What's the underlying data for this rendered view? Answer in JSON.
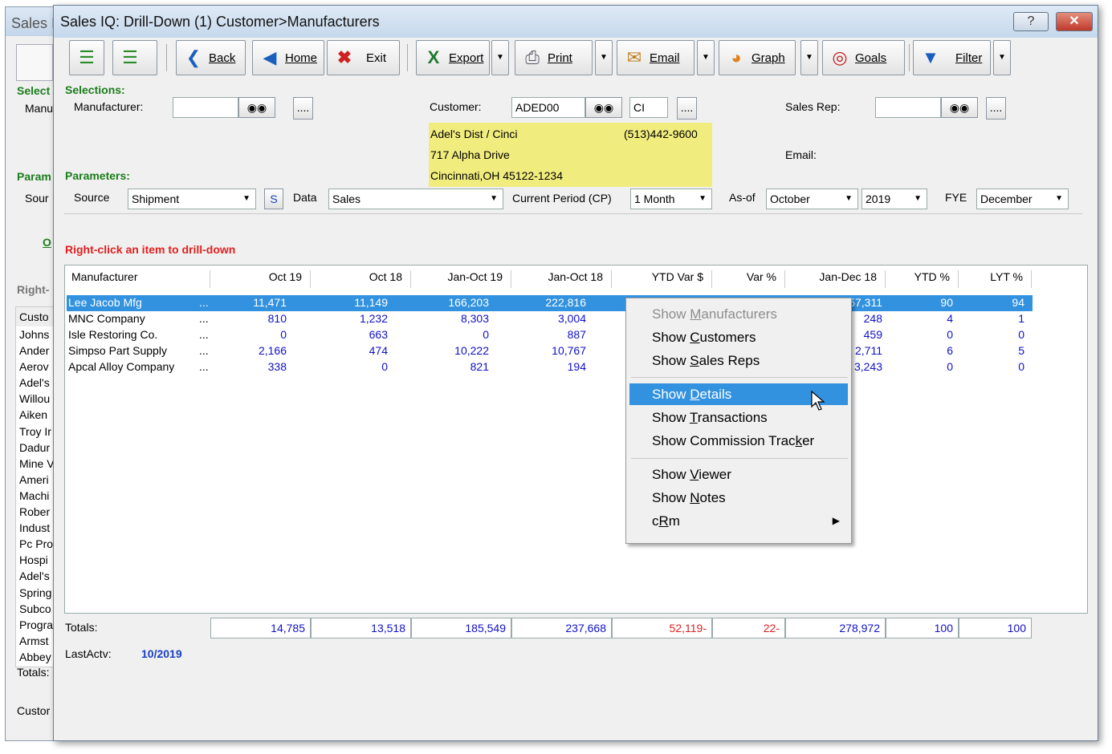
{
  "bg_window": {
    "title": "Sales I",
    "labels": [
      "Select",
      "Manu",
      "Param",
      "Sour",
      "O",
      "Right-",
      "Custo",
      "Totals:",
      "Custor"
    ],
    "list": [
      "Johns",
      "Ander",
      "Aerov",
      "Adel's",
      "Willou",
      "Aiken",
      "Troy Ir",
      "Dadur",
      "Mine V",
      "Ameri",
      "Machi",
      "Rober",
      "Indust",
      "Pc Pro",
      "Hospi",
      "Adel's",
      "Spring",
      "Subco",
      "Progra",
      "Armst",
      "Abbey"
    ]
  },
  "window": {
    "title": "Sales IQ: Drill-Down (1) Customer>Manufacturers",
    "help": "?",
    "close": "✕"
  },
  "toolbar": {
    "back": "Back",
    "home": "Home",
    "exit": "Exit",
    "export": "Export",
    "print": "Print",
    "email": "Email",
    "graph": "Graph",
    "goals": "Goals",
    "filter": "Filter"
  },
  "selections": {
    "heading": "Selections:",
    "manufacturer_label": "Manufacturer:",
    "manufacturer_value": "",
    "customer_label": "Customer:",
    "customer_code": "ADED00",
    "customer_suffix": "CI",
    "salesrep_label": "Sales Rep:",
    "salesrep_value": "",
    "more": "....",
    "customer_name": "Adel's Dist / Cinci",
    "customer_phone": "(513)442-9600",
    "customer_address": "717 Alpha Drive",
    "customer_city": "Cincinnati,OH 45122-1234",
    "email_label": "Email:"
  },
  "parameters": {
    "heading": "Parameters:",
    "source_label": "Source",
    "source_value": "Shipment",
    "s_btn": "S",
    "data_label": "Data",
    "data_value": "Sales",
    "cp_label": "Current Period (CP)",
    "cp_value": "1 Month",
    "asof_label": "As-of",
    "asof_month": "October",
    "asof_year": "2019",
    "fye_label": "FYE",
    "fye_value": "December"
  },
  "hint": "Right-click an item to drill-down",
  "grid": {
    "columns": [
      "Manufacturer",
      "Oct 19",
      "Oct 18",
      "Jan-Oct 19",
      "Jan-Oct 18",
      "YTD Var $",
      "Var %",
      "Jan-Dec 18",
      "YTD %",
      "LYT %"
    ],
    "rows": [
      {
        "name": "Lee Jacob Mfg",
        "dots": "...",
        "c1": "11,471",
        "c2": "11,149",
        "c3": "166,203",
        "c4": "222,816",
        "c7": "257,311",
        "c8": "90",
        "c9": "94"
      },
      {
        "name": "MNC Company",
        "dots": "...",
        "c1": "810",
        "c2": "1,232",
        "c3": "8,303",
        "c4": "3,004",
        "c7": "248",
        "c8": "4",
        "c9": "1"
      },
      {
        "name": "Isle Restoring Co.",
        "dots": "...",
        "c1": "0",
        "c2": "663",
        "c3": "0",
        "c4": "887",
        "c7": "459",
        "c8": "0",
        "c9": "0"
      },
      {
        "name": "Simpso Part Supply",
        "dots": "...",
        "c1": "2,166",
        "c2": "474",
        "c3": "10,222",
        "c4": "10,767",
        "c7": "2,711",
        "c8": "6",
        "c9": "5"
      },
      {
        "name": "Apcal Alloy Company",
        "dots": "...",
        "c1": "338",
        "c2": "0",
        "c3": "821",
        "c4": "194",
        "c7": "3,243",
        "c8": "0",
        "c9": "0"
      }
    ]
  },
  "totals": {
    "label": "Totals:",
    "values": [
      "14,785",
      "13,518",
      "185,549",
      "237,668",
      "52,119-",
      "22-",
      "278,972",
      "100",
      "100"
    ],
    "last_actv_label": "LastActv:",
    "last_actv_value": "10/2019"
  },
  "context_menu": {
    "manufacturers": [
      "Show ",
      "M",
      "anufacturers"
    ],
    "customers": [
      "Show ",
      "C",
      "ustomers"
    ],
    "salesreps": [
      "Show ",
      "S",
      "ales Reps"
    ],
    "details": [
      "Show ",
      "D",
      "etails"
    ],
    "transactions": [
      "Show ",
      "T",
      "ransactions"
    ],
    "commission": [
      "Show Commission Trac",
      "k",
      "er"
    ],
    "viewer": [
      "Show ",
      "V",
      "iewer"
    ],
    "notes": [
      "Show ",
      "N",
      "otes"
    ],
    "crm": [
      "c",
      "R",
      "m"
    ]
  },
  "colors": {
    "accent": "#3292e0",
    "negative": "#e02020",
    "value_blue": "#1010c8",
    "highlight_yellow": "#f1ec7e",
    "label_green": "#1b7d1b"
  }
}
